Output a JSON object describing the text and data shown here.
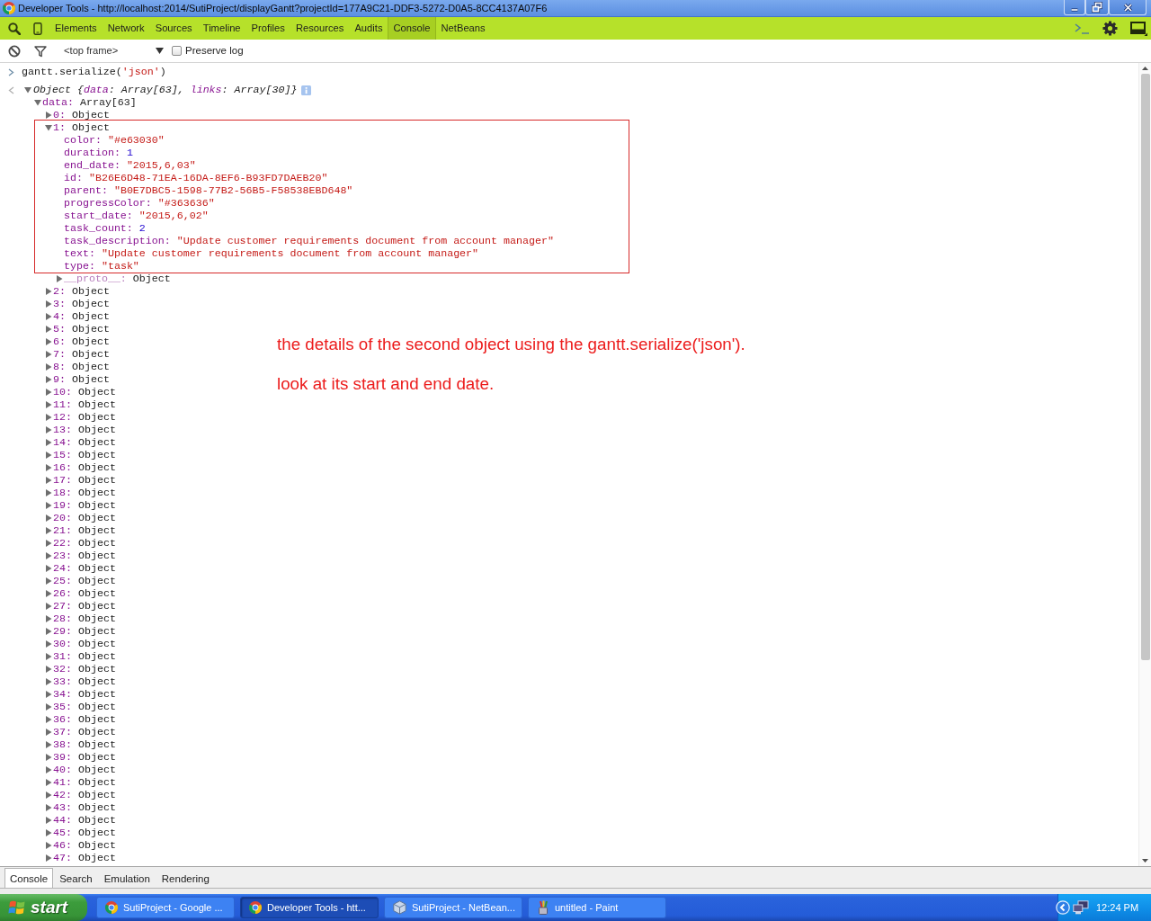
{
  "window": {
    "title": "Developer Tools - http://localhost:2014/SutiProject/displayGantt?projectId=177A9C21-DDF3-5272-D0A5-8CC4137A07F6"
  },
  "toolbar": {
    "tabs": [
      {
        "label": "Elements",
        "selected": false
      },
      {
        "label": "Network",
        "selected": false
      },
      {
        "label": "Sources",
        "selected": false
      },
      {
        "label": "Timeline",
        "selected": false
      },
      {
        "label": "Profiles",
        "selected": false
      },
      {
        "label": "Resources",
        "selected": false
      },
      {
        "label": "Audits",
        "selected": false
      },
      {
        "label": "Console",
        "selected": true
      },
      {
        "label": "NetBeans",
        "selected": false
      }
    ]
  },
  "filter_bar": {
    "frame_select": {
      "value": "<top frame>"
    },
    "preserve_log": {
      "label": "Preserve log",
      "checked": false
    }
  },
  "console": {
    "command": [
      {
        "text": "gantt.serialize(",
        "kind": "plain"
      },
      {
        "text": "'json'",
        "kind": "string"
      },
      {
        "text": ")",
        "kind": "plain"
      }
    ],
    "result": {
      "summary": [
        {
          "text": "Object {",
          "kind": "plain"
        },
        {
          "text": "data",
          "kind": "name"
        },
        {
          "text": ": Array[63], ",
          "kind": "plain"
        },
        {
          "text": "links",
          "kind": "name"
        },
        {
          "text": ": Array[30]}",
          "kind": "plain"
        }
      ],
      "expanded": true,
      "children": [
        {
          "name": "data:",
          "value": "Array[63]",
          "kind": "object",
          "expanded": true,
          "children": [
            {
              "name": "0:",
              "value": "Object",
              "kind": "object",
              "expanded": false,
              "highlighted": false
            },
            {
              "name": "1:",
              "value": "Object",
              "kind": "object",
              "expanded": true,
              "highlighted": true,
              "children": [
                {
                  "name": "color:",
                  "value": "\"#e63030\"",
                  "kind": "string"
                },
                {
                  "name": "duration:",
                  "value": "1",
                  "kind": "number"
                },
                {
                  "name": "end_date:",
                  "value": "\"2015,6,03\"",
                  "kind": "string"
                },
                {
                  "name": "id:",
                  "value": "\"B26E6D48-71EA-16DA-8EF6-B93FD7DAEB20\"",
                  "kind": "string"
                },
                {
                  "name": "parent:",
                  "value": "\"B0E7DBC5-1598-77B2-56B5-F58538EBD648\"",
                  "kind": "string"
                },
                {
                  "name": "progressColor:",
                  "value": "\"#363636\"",
                  "kind": "string"
                },
                {
                  "name": "start_date:",
                  "value": "\"2015,6,02\"",
                  "kind": "string"
                },
                {
                  "name": "task_count:",
                  "value": "2",
                  "kind": "number"
                },
                {
                  "name": "task_description:",
                  "value": "\"Update customer requirements document from account manager\"",
                  "kind": "string"
                },
                {
                  "name": "text:",
                  "value": "\"Update customer requirements document from account manager\"",
                  "kind": "string"
                },
                {
                  "name": "type:",
                  "value": "\"task\"",
                  "kind": "string"
                },
                {
                  "name": "__proto__:",
                  "value": "Object",
                  "kind": "internal",
                  "expanded": false
                }
              ]
            },
            {
              "name": "2:",
              "value": "Object",
              "kind": "object",
              "expanded": false,
              "highlighted": false
            },
            {
              "name": "3:",
              "value": "Object",
              "kind": "object",
              "expanded": false,
              "highlighted": false
            },
            {
              "name": "4:",
              "value": "Object",
              "kind": "object",
              "expanded": false,
              "highlighted": false
            },
            {
              "name": "5:",
              "value": "Object",
              "kind": "object",
              "expanded": false,
              "highlighted": false
            },
            {
              "name": "6:",
              "value": "Object",
              "kind": "object",
              "expanded": false,
              "highlighted": false
            },
            {
              "name": "7:",
              "value": "Object",
              "kind": "object",
              "expanded": false,
              "highlighted": false
            },
            {
              "name": "8:",
              "value": "Object",
              "kind": "object",
              "expanded": false,
              "highlighted": false
            },
            {
              "name": "9:",
              "value": "Object",
              "kind": "object",
              "expanded": false,
              "highlighted": false
            },
            {
              "name": "10:",
              "value": "Object",
              "kind": "object",
              "expanded": false,
              "highlighted": false
            },
            {
              "name": "11:",
              "value": "Object",
              "kind": "object",
              "expanded": false,
              "highlighted": false
            },
            {
              "name": "12:",
              "value": "Object",
              "kind": "object",
              "expanded": false,
              "highlighted": false
            },
            {
              "name": "13:",
              "value": "Object",
              "kind": "object",
              "expanded": false,
              "highlighted": false
            },
            {
              "name": "14:",
              "value": "Object",
              "kind": "object",
              "expanded": false,
              "highlighted": false
            },
            {
              "name": "15:",
              "value": "Object",
              "kind": "object",
              "expanded": false,
              "highlighted": false
            },
            {
              "name": "16:",
              "value": "Object",
              "kind": "object",
              "expanded": false,
              "highlighted": false
            },
            {
              "name": "17:",
              "value": "Object",
              "kind": "object",
              "expanded": false,
              "highlighted": false
            },
            {
              "name": "18:",
              "value": "Object",
              "kind": "object",
              "expanded": false,
              "highlighted": false
            },
            {
              "name": "19:",
              "value": "Object",
              "kind": "object",
              "expanded": false,
              "highlighted": false
            },
            {
              "name": "20:",
              "value": "Object",
              "kind": "object",
              "expanded": false,
              "highlighted": false
            },
            {
              "name": "21:",
              "value": "Object",
              "kind": "object",
              "expanded": false,
              "highlighted": false
            },
            {
              "name": "22:",
              "value": "Object",
              "kind": "object",
              "expanded": false,
              "highlighted": false
            },
            {
              "name": "23:",
              "value": "Object",
              "kind": "object",
              "expanded": false,
              "highlighted": false
            },
            {
              "name": "24:",
              "value": "Object",
              "kind": "object",
              "expanded": false,
              "highlighted": false
            },
            {
              "name": "25:",
              "value": "Object",
              "kind": "object",
              "expanded": false,
              "highlighted": false
            },
            {
              "name": "26:",
              "value": "Object",
              "kind": "object",
              "expanded": false,
              "highlighted": false
            },
            {
              "name": "27:",
              "value": "Object",
              "kind": "object",
              "expanded": false,
              "highlighted": false
            },
            {
              "name": "28:",
              "value": "Object",
              "kind": "object",
              "expanded": false,
              "highlighted": false
            },
            {
              "name": "29:",
              "value": "Object",
              "kind": "object",
              "expanded": false,
              "highlighted": false
            },
            {
              "name": "30:",
              "value": "Object",
              "kind": "object",
              "expanded": false,
              "highlighted": false
            },
            {
              "name": "31:",
              "value": "Object",
              "kind": "object",
              "expanded": false,
              "highlighted": false
            },
            {
              "name": "32:",
              "value": "Object",
              "kind": "object",
              "expanded": false,
              "highlighted": false
            },
            {
              "name": "33:",
              "value": "Object",
              "kind": "object",
              "expanded": false,
              "highlighted": false
            },
            {
              "name": "34:",
              "value": "Object",
              "kind": "object",
              "expanded": false,
              "highlighted": false
            },
            {
              "name": "35:",
              "value": "Object",
              "kind": "object",
              "expanded": false,
              "highlighted": false
            },
            {
              "name": "36:",
              "value": "Object",
              "kind": "object",
              "expanded": false,
              "highlighted": false
            },
            {
              "name": "37:",
              "value": "Object",
              "kind": "object",
              "expanded": false,
              "highlighted": false
            },
            {
              "name": "38:",
              "value": "Object",
              "kind": "object",
              "expanded": false,
              "highlighted": false
            },
            {
              "name": "39:",
              "value": "Object",
              "kind": "object",
              "expanded": false,
              "highlighted": false
            },
            {
              "name": "40:",
              "value": "Object",
              "kind": "object",
              "expanded": false,
              "highlighted": false
            },
            {
              "name": "41:",
              "value": "Object",
              "kind": "object",
              "expanded": false,
              "highlighted": false
            },
            {
              "name": "42:",
              "value": "Object",
              "kind": "object",
              "expanded": false,
              "highlighted": false
            },
            {
              "name": "43:",
              "value": "Object",
              "kind": "object",
              "expanded": false,
              "highlighted": false
            },
            {
              "name": "44:",
              "value": "Object",
              "kind": "object",
              "expanded": false,
              "highlighted": false
            },
            {
              "name": "45:",
              "value": "Object",
              "kind": "object",
              "expanded": false,
              "highlighted": false
            },
            {
              "name": "46:",
              "value": "Object",
              "kind": "object",
              "expanded": false,
              "highlighted": false
            },
            {
              "name": "47:",
              "value": "Object",
              "kind": "object",
              "expanded": false,
              "highlighted": false
            }
          ]
        }
      ]
    }
  },
  "annotation": {
    "lines": [
      "the details of the second object using the gantt.serialize('json').",
      "look at its start and end date."
    ]
  },
  "drawer": {
    "tabs": [
      {
        "label": "Console",
        "selected": true
      },
      {
        "label": "Search",
        "selected": false
      },
      {
        "label": "Emulation",
        "selected": false
      },
      {
        "label": "Rendering",
        "selected": false
      }
    ]
  },
  "taskbar": {
    "start": "start",
    "tasks": [
      {
        "label": "SutiProject - Google ...",
        "kind": "browser",
        "selected": false
      },
      {
        "label": "Developer Tools - htt...",
        "kind": "browser",
        "selected": true
      },
      {
        "label": "SutiProject - NetBean...",
        "kind": "ide",
        "selected": false
      },
      {
        "label": "untitled - Paint",
        "kind": "paint",
        "selected": false
      }
    ],
    "clock": "12:24 PM"
  }
}
